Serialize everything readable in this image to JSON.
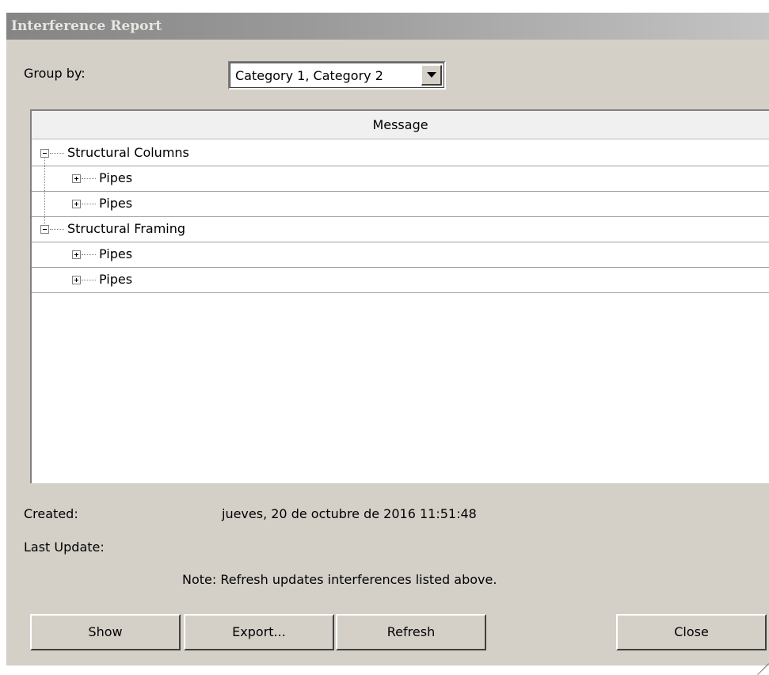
{
  "window": {
    "title": "Interference Report"
  },
  "group_by": {
    "label": "Group by:",
    "value": "Category 1, Category 2"
  },
  "tree": {
    "column_header": "Message",
    "rows": [
      {
        "label": "Structural Columns",
        "level": 0,
        "expanded": true
      },
      {
        "label": "Pipes",
        "level": 1,
        "expanded": false
      },
      {
        "label": "Pipes",
        "level": 1,
        "expanded": false
      },
      {
        "label": "Structural Framing",
        "level": 0,
        "expanded": true
      },
      {
        "label": "Pipes",
        "level": 1,
        "expanded": false
      },
      {
        "label": "Pipes",
        "level": 1,
        "expanded": false
      }
    ]
  },
  "info": {
    "created_label": "Created:",
    "created_value": "jueves, 20 de octubre de 2016 11:51:48",
    "last_update_label": "Last Update:",
    "last_update_value": "",
    "note": "Note: Refresh updates interferences listed above."
  },
  "buttons": {
    "show": "Show",
    "export": "Export...",
    "refresh": "Refresh",
    "close": "Close"
  }
}
